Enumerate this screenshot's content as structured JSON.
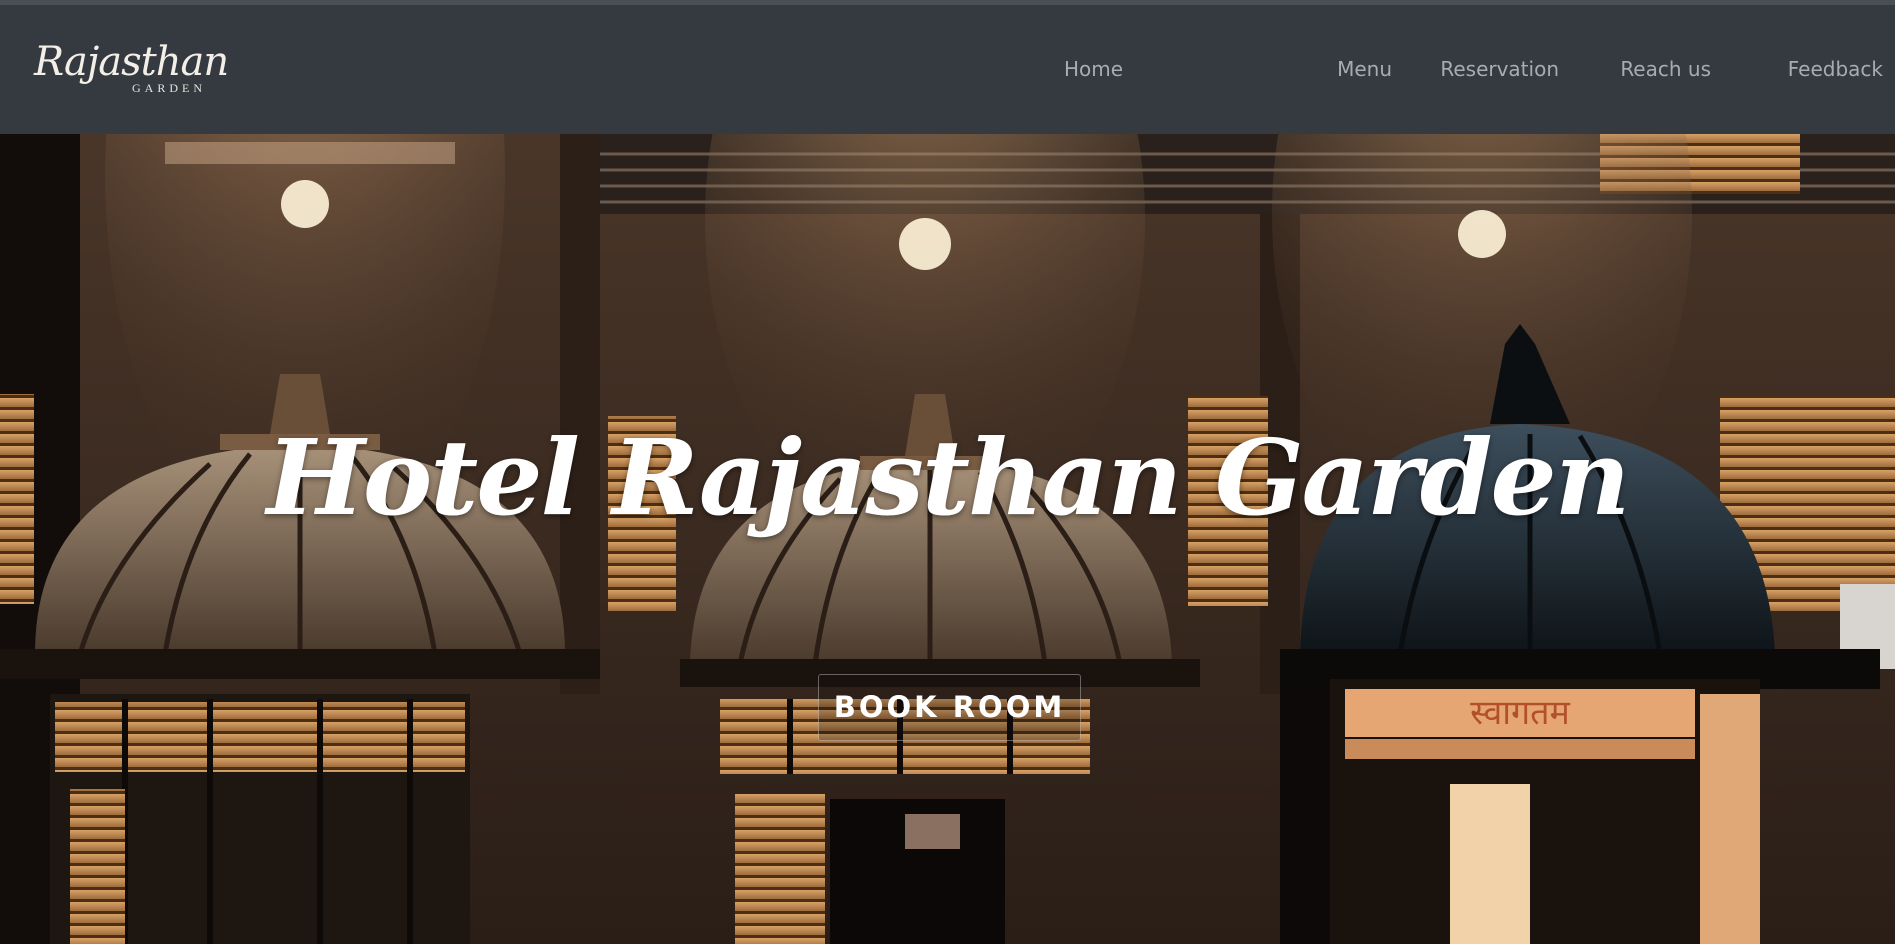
{
  "navbar": {
    "brand": {
      "script": "Rajasthan",
      "sub": "GARDEN"
    },
    "links": [
      {
        "label": "Home"
      },
      {
        "label": "Menu"
      },
      {
        "label": "Reservation"
      },
      {
        "label": "Reach us"
      },
      {
        "label": "Feedback"
      }
    ]
  },
  "hero": {
    "title": "Hotel Rajasthan Garden",
    "button_label": "BOOK ROOM",
    "sign_text": "स्वागतम"
  },
  "colors": {
    "navbar_bg": "#343a40",
    "nav_link": "#a9acaf",
    "hero_text": "#ffffff"
  }
}
